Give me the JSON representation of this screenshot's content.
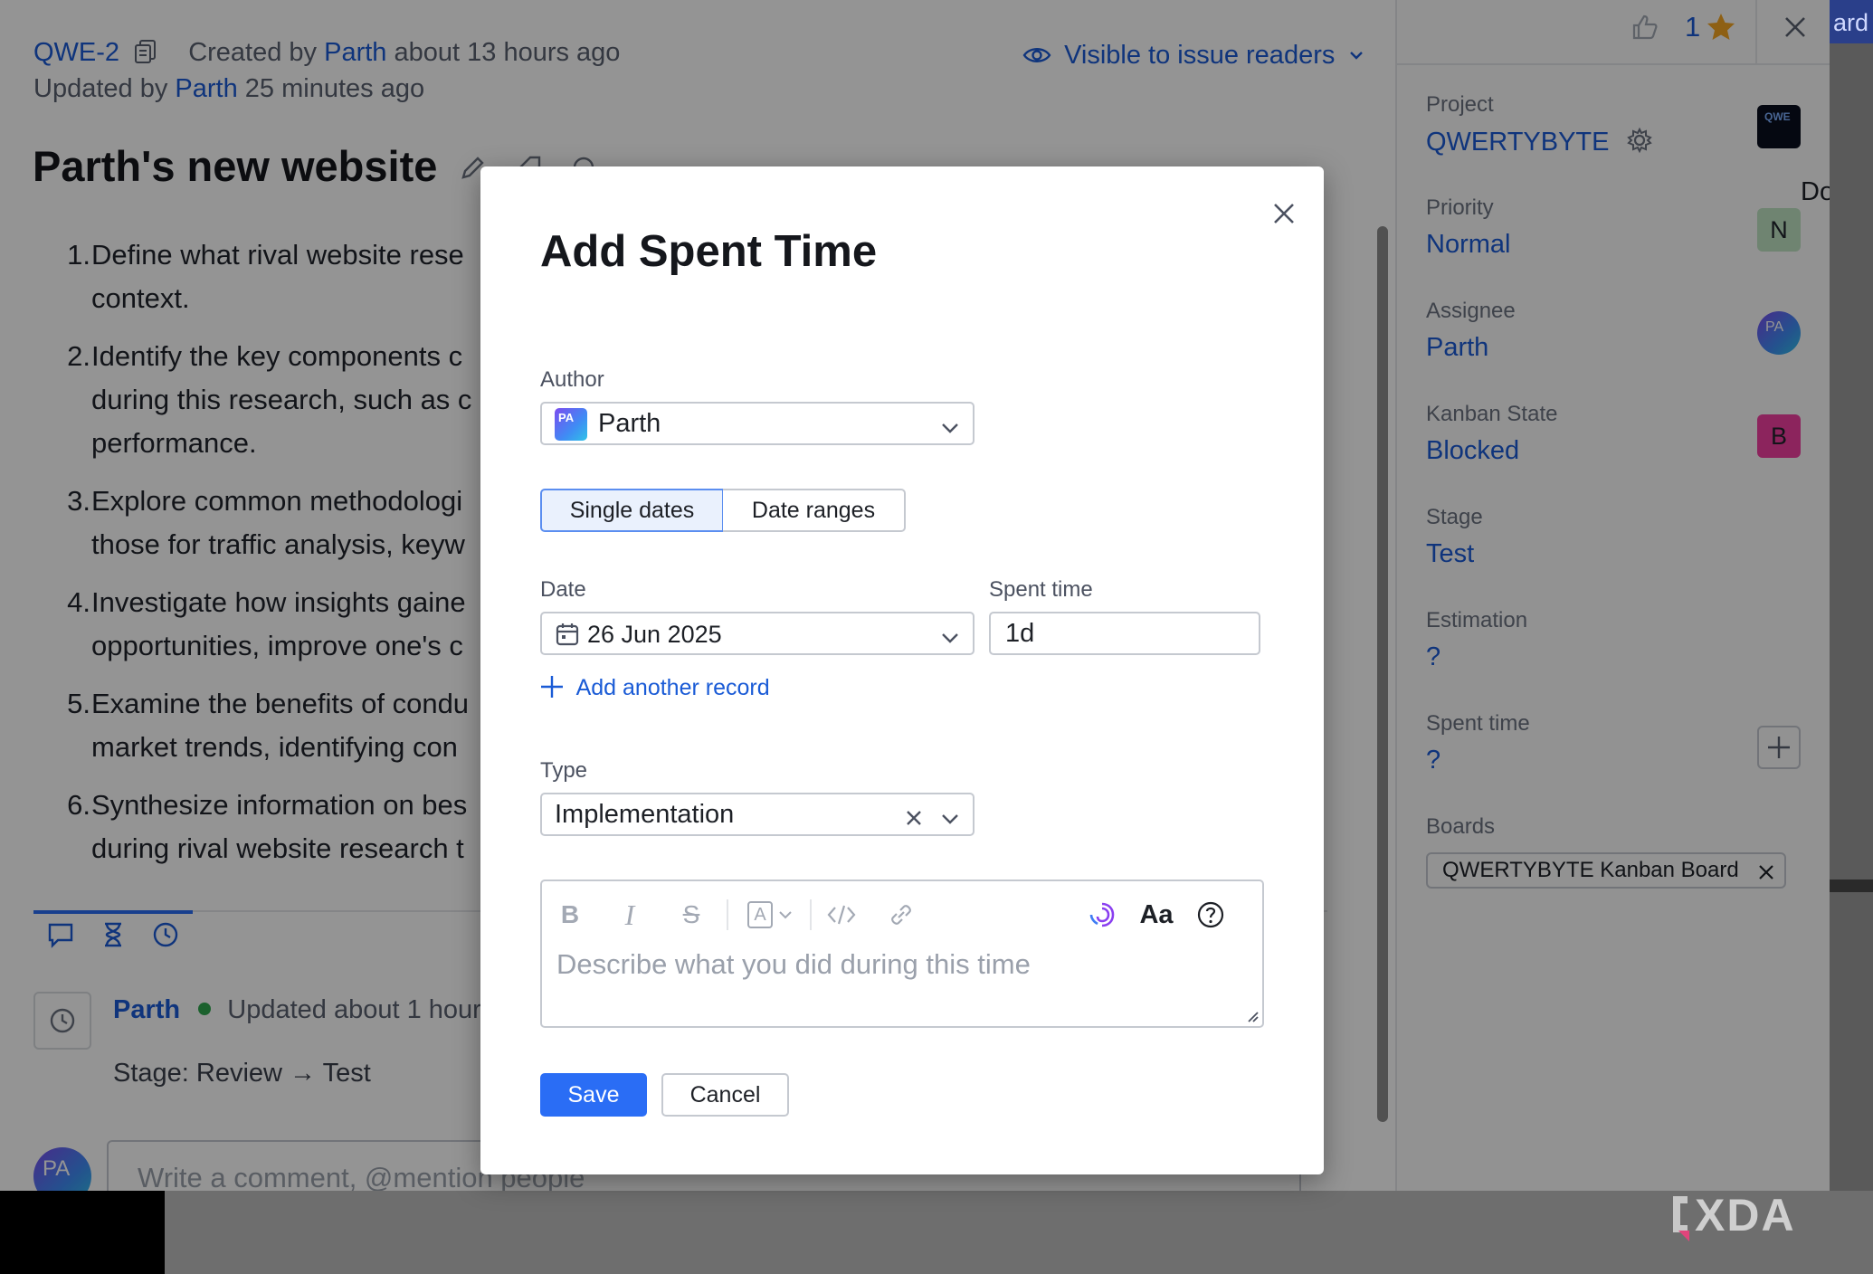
{
  "issue": {
    "id": "QWE-2",
    "created_prefix": "Created by",
    "created_by": "Parth",
    "created_suffix": "about 13 hours ago",
    "updated_prefix": "Updated by",
    "updated_by": "Parth",
    "updated_suffix": "25 minutes ago",
    "visibility": "Visible to issue readers",
    "title": "Parth's new website",
    "description": [
      {
        "num": "1.",
        "lines": [
          "Define what rival website rese",
          "context."
        ]
      },
      {
        "num": "2.",
        "lines": [
          "Identify the key components c",
          "during this research, such as c",
          "performance."
        ]
      },
      {
        "num": "3.",
        "lines": [
          "Explore common methodologi",
          "those for traffic analysis, keyw"
        ]
      },
      {
        "num": "4.",
        "lines": [
          "Investigate how insights gaine",
          "opportunities, improve one's c"
        ]
      },
      {
        "num": "5.",
        "lines": [
          "Examine the benefits of condu",
          "market trends, identifying con"
        ]
      },
      {
        "num": "6.",
        "lines": [
          "Synthesize information on bes",
          "during rival website research t"
        ]
      }
    ],
    "activity": {
      "author": "Parth",
      "status": "Updated about 1 hour",
      "change": "Stage: Review → Test"
    },
    "comment_placeholder": "Write a comment, @mention people",
    "commenter_initials": "PA"
  },
  "topbar": {
    "vote_count": "1",
    "partial_text": "ard"
  },
  "sidebar": {
    "project_label": "Project",
    "project_value": "QWERTYBYTE",
    "project_logo_text": "QWE",
    "priority_label": "Priority",
    "priority_value": "Normal",
    "priority_badge": "N",
    "assignee_label": "Assignee",
    "assignee_value": "Parth",
    "assignee_initials": "PA",
    "kanban_label": "Kanban State",
    "kanban_value": "Blocked",
    "kanban_badge": "B",
    "stage_label": "Stage",
    "stage_value": "Test",
    "estimation_label": "Estimation",
    "estimation_value": "?",
    "spent_label": "Spent time",
    "spent_value": "?",
    "boards_label": "Boards",
    "board_tag": "QWERTYBYTE Kanban Board",
    "partial_right": "Don"
  },
  "modal": {
    "title": "Add Spent Time",
    "author_label": "Author",
    "author_value": "Parth",
    "author_initials": "PA",
    "mode_single": "Single dates",
    "mode_range": "Date ranges",
    "date_label": "Date",
    "date_value": "26 Jun 2025",
    "spent_label": "Spent time",
    "spent_value": "1d",
    "add_record": "Add another record",
    "type_label": "Type",
    "type_value": "Implementation",
    "editor_placeholder": "Describe what you did during this time",
    "save_label": "Save",
    "cancel_label": "Cancel"
  },
  "colors": {
    "accent": "#2a6df5",
    "link": "#1a5bd6",
    "priority_badge_bg": "#bfe3c3",
    "kanban_badge_bg": "#f23ea0",
    "status_dot": "#2fa84f"
  },
  "watermark": "XDA"
}
